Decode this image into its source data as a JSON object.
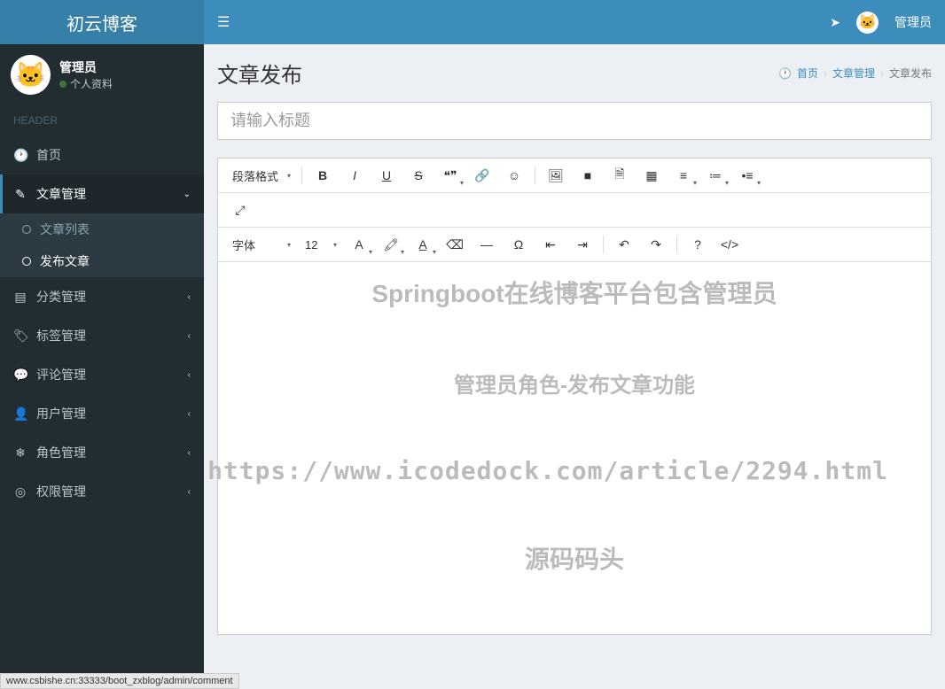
{
  "app": {
    "logo": "初云博客"
  },
  "header": {
    "user_label": "管理员"
  },
  "sidebar": {
    "user_name": "管理员",
    "user_status": "个人资料",
    "section_label": "HEADER",
    "items": [
      {
        "label": "首页",
        "icon": "⚙"
      },
      {
        "label": "文章管理",
        "icon": "✎",
        "expanded": true
      },
      {
        "label": "分类管理",
        "icon": "📖"
      },
      {
        "label": "标签管理",
        "icon": "🏷"
      },
      {
        "label": "评论管理",
        "icon": "💬"
      },
      {
        "label": "用户管理",
        "icon": "👤"
      },
      {
        "label": "角色管理",
        "icon": "❄"
      },
      {
        "label": "权限管理",
        "icon": "◎"
      }
    ],
    "submenu": [
      {
        "label": "文章列表"
      },
      {
        "label": "发布文章",
        "active": true
      }
    ]
  },
  "page": {
    "title": "文章发布",
    "breadcrumb_home": "首页",
    "breadcrumb_mid": "文章管理",
    "breadcrumb_current": "文章发布"
  },
  "form": {
    "title_placeholder": "请输入标题"
  },
  "editor": {
    "para_format": "段落格式",
    "font_family": "字体",
    "font_size": "12"
  },
  "watermarks": {
    "w1": "Springboot在线博客平台包含管理员",
    "w2": "管理员角色-发布文章功能",
    "w3": "https://www.icodedock.com/article/2294.html",
    "w4": "源码码头"
  },
  "status_bar": "www.csbishe.cn:33333/boot_zxblog/admin/comment"
}
